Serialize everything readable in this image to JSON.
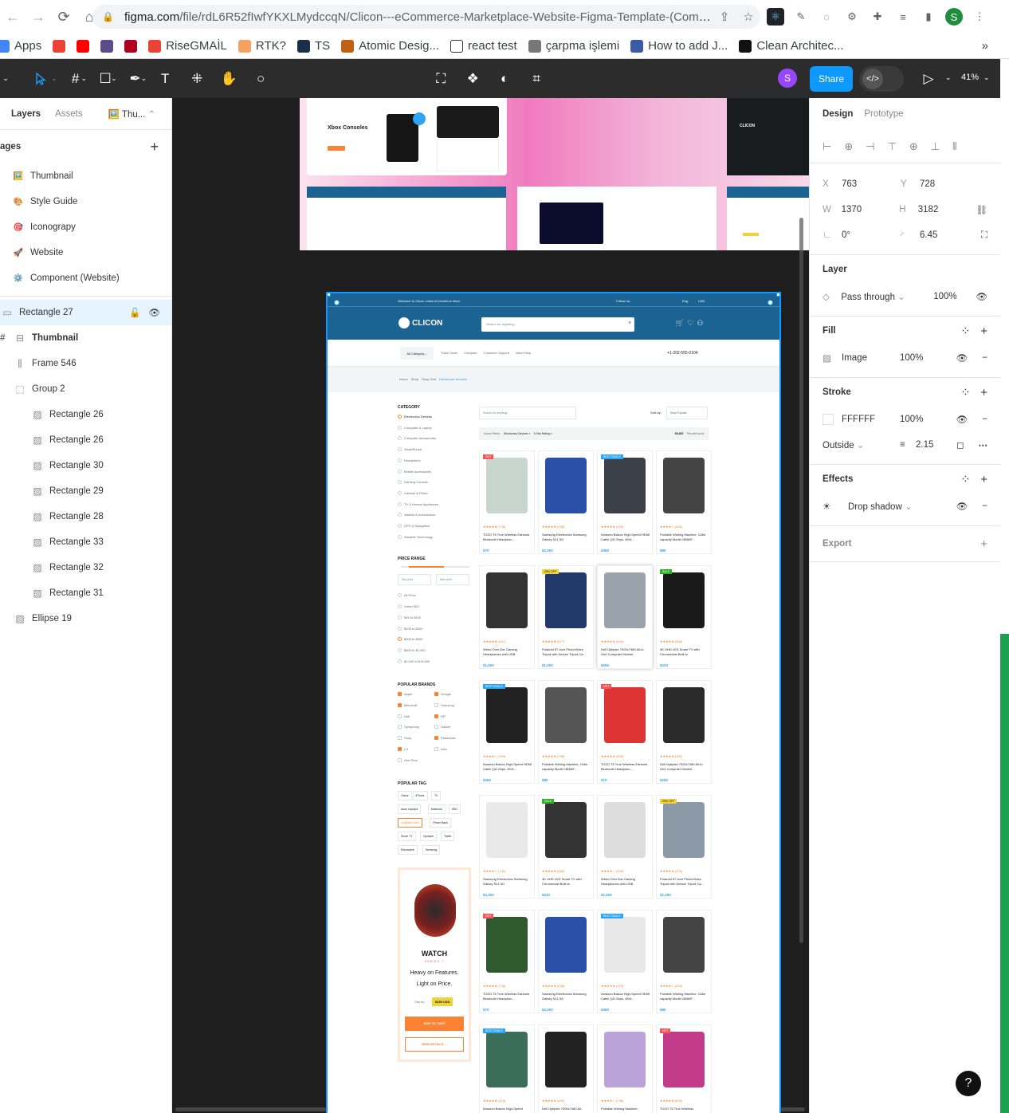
{
  "browser": {
    "url_domain": "figma.com",
    "url_path": "/file/rdL6R52fIwfYKXLMydccqN/Clicon---eCommerce-Marketplace-Website-Figma-Template-(Communit...",
    "profile_initial": "S"
  },
  "bookmarks": [
    {
      "label": "Apps",
      "color": "#4285f4"
    },
    {
      "label": "",
      "color": "#ea4335"
    },
    {
      "label": "",
      "color": "#ff0000"
    },
    {
      "label": "",
      "color": "#5c4b8a"
    },
    {
      "label": "",
      "color": "#b00020"
    },
    {
      "label": "RiseGMAİL",
      "color": "#ea4335"
    },
    {
      "label": "RTK?",
      "color": "#f4a261"
    },
    {
      "label": "TS",
      "color": "#1c2f4a"
    },
    {
      "label": "Atomic Desig...",
      "color": "#c06010"
    },
    {
      "label": "react test",
      "color": "#ffffff"
    },
    {
      "label": "çarpma işlemi",
      "color": "#777777"
    },
    {
      "label": "How to add J...",
      "color": "#3b5ba5"
    },
    {
      "label": "Clean Architec...",
      "color": "#111111"
    }
  ],
  "toolbar": {
    "share_label": "Share",
    "zoom": "41%",
    "user_initial": "S"
  },
  "left_panel": {
    "tab_layers": "Layers",
    "tab_assets": "Assets",
    "page_current": "Thu...",
    "pages_header": "ages",
    "pages": [
      {
        "icon": "🖼️",
        "label": "Thumbnail"
      },
      {
        "icon": "🎨",
        "label": "Style Guide"
      },
      {
        "icon": "🎯",
        "label": "Iconograpy"
      },
      {
        "icon": "🚀",
        "label": "Website"
      },
      {
        "icon": "⚙️",
        "label": "Component (Website)"
      }
    ],
    "layers": [
      {
        "label": "Rectangle 27",
        "indent": 0,
        "selected": true,
        "icon": "rect"
      },
      {
        "label": "Thumbnail",
        "indent": 0,
        "bold": true,
        "icon": "frame"
      },
      {
        "label": "Frame 546",
        "indent": 1,
        "icon": "frame-v"
      },
      {
        "label": "Group 2",
        "indent": 1,
        "icon": "group"
      },
      {
        "label": "Rectangle 26",
        "indent": 2,
        "icon": "image"
      },
      {
        "label": "Rectangle 26",
        "indent": 2,
        "icon": "image"
      },
      {
        "label": "Rectangle 30",
        "indent": 2,
        "icon": "image"
      },
      {
        "label": "Rectangle 29",
        "indent": 2,
        "icon": "image"
      },
      {
        "label": "Rectangle 28",
        "indent": 2,
        "icon": "image"
      },
      {
        "label": "Rectangle 33",
        "indent": 2,
        "icon": "image"
      },
      {
        "label": "Rectangle 32",
        "indent": 2,
        "icon": "image"
      },
      {
        "label": "Rectangle 31",
        "indent": 2,
        "icon": "image"
      },
      {
        "label": "Ellipse 19",
        "indent": 1,
        "icon": "image"
      }
    ]
  },
  "right_panel": {
    "tab_design": "Design",
    "tab_prototype": "Prototype",
    "x": "763",
    "y": "728",
    "w": "1370",
    "h": "3182",
    "rotation": "0°",
    "radius": "6.45",
    "layer_title": "Layer",
    "blend": "Pass through",
    "layer_opacity": "100%",
    "fill_title": "Fill",
    "fill_type": "Image",
    "fill_opacity": "100%",
    "stroke_title": "Stroke",
    "stroke_color": "FFFFFF",
    "stroke_opacity": "100%",
    "stroke_position": "Outside",
    "stroke_width": "2.15",
    "effects_title": "Effects",
    "effect_type": "Drop shadow",
    "export_title": "Export"
  },
  "canvas": {
    "xbox_title": "Xbox Consoles",
    "clicon_brand": "CLICON",
    "welcome": "Welcome to Clicon online eCommerce store.",
    "follow_us": "Follow us:",
    "lang": "Eng",
    "currency": "USD",
    "search_placeholder": "Search for anything...",
    "all_category": "All Category",
    "nav_links": [
      "Track Order",
      "Compare",
      "Customer Support",
      "Need Help"
    ],
    "phone": "+1-202-555-0104",
    "breadcrumb": [
      "Home",
      "Shop",
      "Shop Grid",
      "Electronics Devices"
    ],
    "category_title": "CATEGORY",
    "categories": [
      "Electronics Devices",
      "Computer & Laptop",
      "Computer Accessories",
      "SmartPhone",
      "Headphone",
      "Mobile Accessories",
      "Gaming Console",
      "Camera & Photo",
      "TV & Homes Appliances",
      "Watchs & Accessories",
      "GPS & Navigation",
      "Warable Technology"
    ],
    "price_title": "PRICE RANGE",
    "min_price": "Min price",
    "max_price": "Max price",
    "prices": [
      "All Price",
      "Under $20",
      "$25 to $100",
      "$100 to $300",
      "$300 to $500",
      "$500 to $1,000",
      "$1,000 to $10,000"
    ],
    "brands_title": "POPULAR BRANDS",
    "brands": [
      "Apple",
      "Google",
      "Microsoft",
      "Samsung",
      "Dell",
      "HP",
      "Symphony",
      "Xiaomi",
      "Sony",
      "Panasonic",
      "LG",
      "Intel",
      "One Plus"
    ],
    "tags_title": "POPULAR TAG",
    "tags": [
      "Game",
      "iPhone",
      "TV",
      "Asus Laptops",
      "Macbook",
      "SSD",
      "Graphics Card",
      "Power Bank",
      "Smart TV",
      "Speaker",
      "Tablet",
      "Microwave",
      "Samsung"
    ],
    "watch_brand": "WATCH",
    "watch_series": "SERIES 7",
    "watch_tagline_1": "Heavy on Features.",
    "watch_tagline_2": "Light on Price.",
    "only_for": "Only for:",
    "watch_price": "$299 USD",
    "add_to_cart": "ADD TO CART",
    "view_details": "VIEW DETAILS →",
    "filter_search": "Search for anything...",
    "sort_by": "Sort by:",
    "sort_value": "Most Popular",
    "active_filters": "Active Filters:",
    "filter_1": "Electronics Devices ×",
    "filter_2": "5 Star Rating ×",
    "results_count": "65,867",
    "results_label": "Results found.",
    "products": [
      {
        "badge": "HOT",
        "badge_color": "#ee5858",
        "img": "#c8d6d0",
        "stars": "★★★★★ (738)",
        "title": "TOZO T6 True Wireless Earbuds Bluetooth Headphon...",
        "price": "$70"
      },
      {
        "badge": "",
        "badge_color": "",
        "img": "#2a4fa8",
        "stars": "★★★★★ (536)",
        "title": "Samsung Electronics Samsung Galaxy S21 5G",
        "price": "$2,300"
      },
      {
        "badge": "BEST DEALS",
        "badge_color": "#2da5f3",
        "img": "#3a3f48",
        "stars": "★★★★★ (423)",
        "title": "Amazon Basics High-Speed HDMI Cable (18 Gbps, 4K/6...",
        "price": "$360"
      },
      {
        "badge": "",
        "badge_color": "",
        "img": "#444",
        "stars": "★★★★☆ (816)",
        "title": "Portable Wshing Machine, 11lbs capacity Model 18NMF...",
        "price": "$80"
      },
      {
        "badge": "",
        "badge_color": "",
        "img": "#333",
        "stars": "★★★★★ (647)",
        "title": "Wired Over-Ear Gaming Headphones with USB",
        "price": "$1,500"
      },
      {
        "badge": "25% OFF",
        "badge_color": "#efd33d",
        "img": "#223a6a",
        "stars": "★★★★★ (877)",
        "title": "Polaroid 57-Inch Photo/Video Tripod with Deluxe Tripod Ca...",
        "price": "$1,200"
      },
      {
        "badge": "",
        "badge_color": "",
        "img": "#9aa3ab",
        "stars": "★★★★★ (426)",
        "title": "Dell Optiplex 7000x7480 All-in-One Computer Monitor",
        "price": "$250"
      },
      {
        "badge": "SALE",
        "badge_color": "#2db224",
        "img": "#1a1a1a",
        "stars": "★★★★★ (583)",
        "title": "4K UHD LED Smart TV with Chromecast Built-in",
        "price": "$220"
      },
      {
        "badge": "BEST DEALS",
        "badge_color": "#2da5f3",
        "img": "#222",
        "stars": "★★★★☆ (994)",
        "title": "Amazon Basics High-Speed HDMI Cable (18 Gbps, 4K/6...",
        "price": "$360"
      },
      {
        "badge": "",
        "badge_color": "",
        "img": "#555",
        "stars": "★★★★★ (798)",
        "title": "Portable Wshing Machine, 11lbs capacity Model 18NMF...",
        "price": "$80"
      },
      {
        "badge": "HOT",
        "badge_color": "#ee5858",
        "img": "#d33",
        "stars": "★★★★★ (600)",
        "title": "TOZO T6 True Wireless Earbuds Bluetooth Headphon...",
        "price": "$70"
      },
      {
        "badge": "",
        "badge_color": "",
        "img": "#2b2b2b",
        "stars": "★★★★★ (492)",
        "title": "Dell Optiplex 7000x7480 All-in-One Computer Monitor",
        "price": "$250"
      },
      {
        "badge": "",
        "badge_color": "",
        "img": "#e9e9e9",
        "stars": "★★★★☆ (740)",
        "title": "Samsung Electronics Samsung Galaxy S21 5G",
        "price": "$2,300"
      },
      {
        "badge": "SALE",
        "badge_color": "#2db224",
        "img": "#333",
        "stars": "★★★★★ (556)",
        "title": "4K UHD LED Smart TV with Chromecast Built-in",
        "price": "$220"
      },
      {
        "badge": "",
        "badge_color": "",
        "img": "#ddd",
        "stars": "★★★★☆ (536)",
        "title": "Wired Over-Ear Gaming Headphones with USB",
        "price": "$1,500"
      },
      {
        "badge": "25% OFF",
        "badge_color": "#efd33d",
        "img": "#8c9aa8",
        "stars": "★★★★★ (423)",
        "title": "Polaroid 57-Inch Photo/Video Tripod with Deluxe Tripod Ca...",
        "price": "$1,200"
      },
      {
        "badge": "HOT",
        "badge_color": "#ee5858",
        "img": "#2f5a2f",
        "stars": "★★★★★ (738)",
        "title": "TOZO T6 True Wireless Earbuds Bluetooth Headphon...",
        "price": "$70"
      },
      {
        "badge": "",
        "badge_color": "",
        "img": "#2a4fa8",
        "stars": "★★★★★ (536)",
        "title": "Samsung Electronics Samsung Galaxy S21 5G",
        "price": "$2,300"
      },
      {
        "badge": "BEST DEALS",
        "badge_color": "#2da5f3",
        "img": "#e8e8e8",
        "stars": "★★★★★ (423)",
        "title": "Amazon Basics High-Speed HDMI Cable (18 Gbps, 4K/6...",
        "price": "$360"
      },
      {
        "badge": "",
        "badge_color": "",
        "img": "#444",
        "stars": "★★★★☆ (816)",
        "title": "Portable Wshing Machine, 11lbs capacity Model 18NMF...",
        "price": "$80"
      },
      {
        "badge": "BEST DEALS",
        "badge_color": "#2da5f3",
        "img": "#3b6e5a",
        "stars": "★★★★★ (423)",
        "title": "Amazon Basics High-Speed",
        "price": ""
      },
      {
        "badge": "",
        "badge_color": "",
        "img": "#222",
        "stars": "★★★★★ (492)",
        "title": "Dell Optiplex 7000x7480 All-",
        "price": ""
      },
      {
        "badge": "",
        "badge_color": "",
        "img": "#b9a3d8",
        "stars": "★★★★☆ (798)",
        "title": "Portable Wshing Machine,",
        "price": ""
      },
      {
        "badge": "HOT",
        "badge_color": "#ee5858",
        "img": "#c23a8a",
        "stars": "★★★★★ (600)",
        "title": "TOZO T6 True Wireless",
        "price": ""
      }
    ]
  },
  "colors": {
    "figma_blue": "#0d99ff",
    "clicon_blue": "#1b6392",
    "accent_orange": "#fa8232",
    "figma_dark": "#2c2c2c"
  },
  "help_label": "?"
}
